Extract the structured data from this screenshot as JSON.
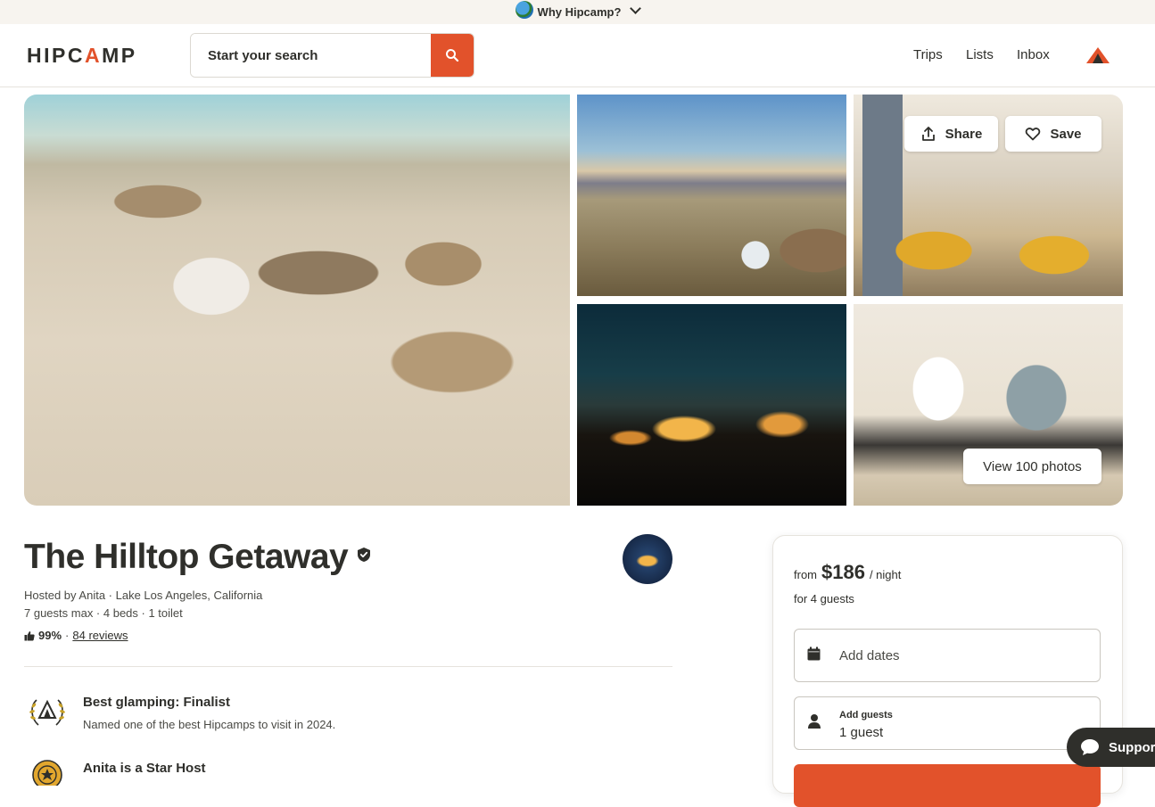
{
  "banner": {
    "text": "Why Hipcamp?"
  },
  "header": {
    "logo_text_left": "HIPC",
    "logo_text_a": "A",
    "logo_text_right": "MP",
    "search": {
      "placeholder": "Start your search",
      "value": ""
    },
    "nav": {
      "trips": "Trips",
      "lists": "Lists",
      "inbox": "Inbox"
    }
  },
  "gallery": {
    "share_label": "Share",
    "save_label": "Save",
    "view_all_label": "View 100 photos"
  },
  "listing": {
    "title": "The Hilltop Getaway",
    "hosted_by": "Hosted by Anita · Lake Los Angeles, California",
    "capacity": "7 guests max · 4 beds · 1 toilet",
    "rating_pct": "99%",
    "rating_sep": "·",
    "reviews_link": "84 reviews",
    "features": [
      {
        "title": "Best glamping: Finalist",
        "desc": "Named one of the best Hipcamps to visit in 2024."
      },
      {
        "title": "Anita is a Star Host",
        "desc": ""
      }
    ]
  },
  "booking": {
    "price_from": "from",
    "price_amount": "$186",
    "price_unit": "/ night",
    "price_guests": "for 4 guests",
    "dates_placeholder": "Add dates",
    "guests_label": "Add guests",
    "guests_value": "1 guest"
  },
  "support": {
    "label": "Support"
  },
  "colors": {
    "accent": "#e2522b",
    "text": "#2f2f2b",
    "banner_bg": "#f7f4ef"
  }
}
